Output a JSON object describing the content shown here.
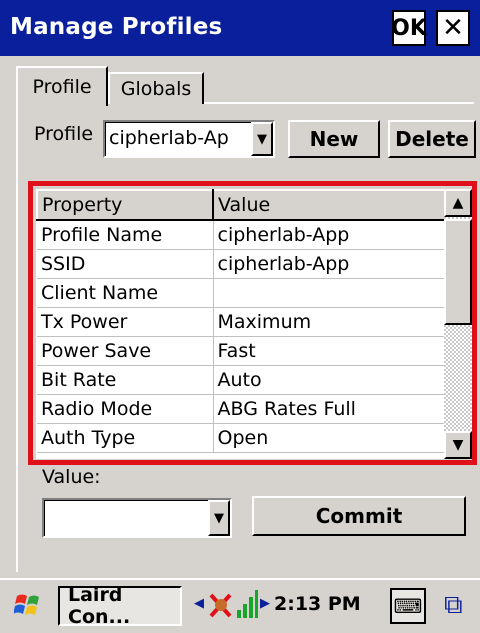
{
  "window": {
    "title": "Manage Profiles",
    "ok_label": "OK",
    "close_label": "✕"
  },
  "tabs": [
    {
      "label": "Profile",
      "active": true
    },
    {
      "label": "Globals",
      "active": false
    }
  ],
  "profile_row": {
    "label": "Profile",
    "selected": "cipherlab-Ap",
    "new_label": "New",
    "delete_label": "Delete"
  },
  "grid": {
    "headers": [
      "Property",
      "Value"
    ],
    "rows": [
      [
        "Profile Name",
        "cipherlab-App"
      ],
      [
        "SSID",
        "cipherlab-App"
      ],
      [
        "Client Name",
        ""
      ],
      [
        "Tx Power",
        "Maximum"
      ],
      [
        "Power Save",
        "Fast"
      ],
      [
        "Bit Rate",
        "Auto"
      ],
      [
        "Radio Mode",
        "ABG Rates Full"
      ],
      [
        "Auth Type",
        "Open"
      ]
    ],
    "highlight_color": "#e0101a"
  },
  "value_row": {
    "label": "Value:",
    "selected": "",
    "commit_label": "Commit"
  },
  "taskbar": {
    "task_label": "Laird Con...",
    "clock": "2:13 PM"
  },
  "colors": {
    "titlebar": "#0a1f9b",
    "face": "#d6d3ce"
  },
  "icons": [
    "windows-start-icon",
    "network-disconnected-icon",
    "signal-icon",
    "keyboard-icon",
    "window-switcher-icon"
  ]
}
